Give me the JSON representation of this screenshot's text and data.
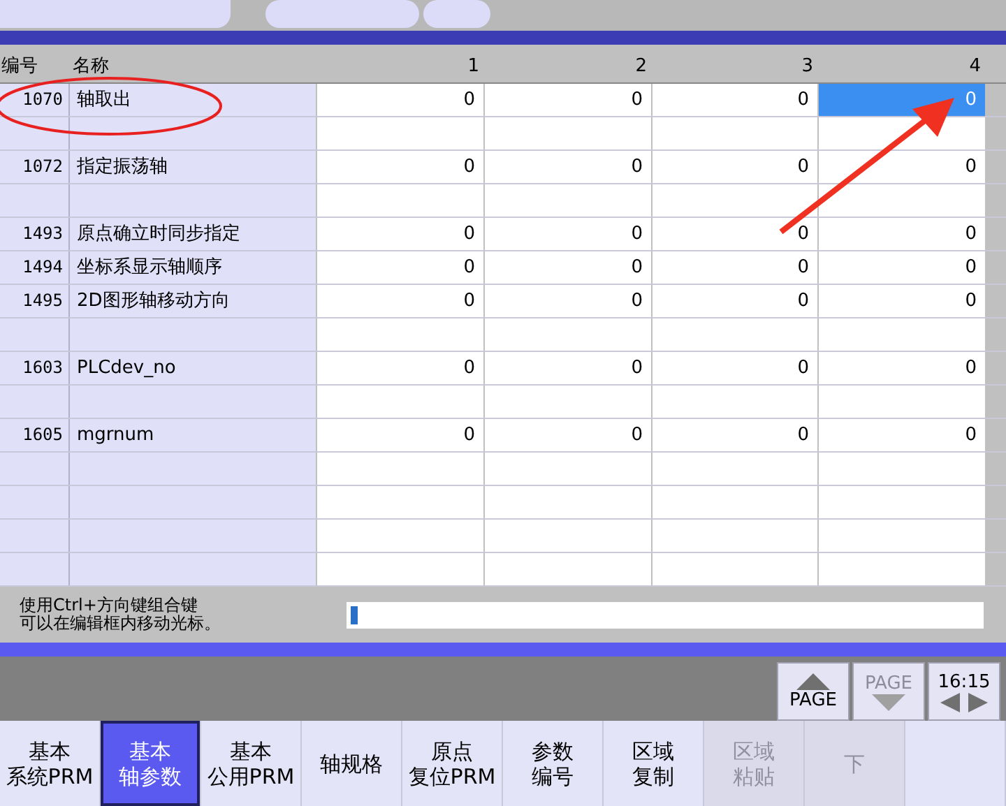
{
  "top_tabs": [
    {
      "selected": false
    },
    {
      "selected": false
    },
    {
      "selected": false
    }
  ],
  "table": {
    "columns": [
      "编号",
      "名称",
      "1",
      "2",
      "3",
      "4"
    ],
    "rows": [
      {
        "kind": "param",
        "number": "1070",
        "name": "轴取出",
        "values": [
          {
            "text": "0",
            "selected": false
          },
          {
            "text": "0",
            "selected": false
          },
          {
            "text": "0",
            "selected": false
          },
          {
            "text": "0",
            "selected": true
          }
        ]
      },
      {
        "kind": "blank"
      },
      {
        "kind": "param",
        "number": "1072",
        "name": "指定振荡轴",
        "values": [
          {
            "text": "0",
            "selected": false
          },
          {
            "text": "0",
            "selected": false
          },
          {
            "text": "0",
            "selected": false
          },
          {
            "text": "0",
            "selected": false
          }
        ]
      },
      {
        "kind": "blank"
      },
      {
        "kind": "param",
        "number": "1493",
        "name": "原点确立时同步指定",
        "values": [
          {
            "text": "0",
            "selected": false
          },
          {
            "text": "0",
            "selected": false
          },
          {
            "text": "0",
            "selected": false
          },
          {
            "text": "0",
            "selected": false
          }
        ]
      },
      {
        "kind": "param",
        "number": "1494",
        "name": "坐标系显示轴顺序",
        "values": [
          {
            "text": "0",
            "selected": false
          },
          {
            "text": "0",
            "selected": false
          },
          {
            "text": "0",
            "selected": false
          },
          {
            "text": "0",
            "selected": false
          }
        ]
      },
      {
        "kind": "param",
        "number": "1495",
        "name": "2D图形轴移动方向",
        "values": [
          {
            "text": "0",
            "selected": false
          },
          {
            "text": "0",
            "selected": false
          },
          {
            "text": "0",
            "selected": false
          },
          {
            "text": "0",
            "selected": false
          }
        ]
      },
      {
        "kind": "blank"
      },
      {
        "kind": "param",
        "number": "1603",
        "name": "PLCdev_no",
        "values": [
          {
            "text": "0",
            "selected": false
          },
          {
            "text": "0",
            "selected": false
          },
          {
            "text": "0",
            "selected": false
          },
          {
            "text": "0",
            "selected": false
          }
        ]
      },
      {
        "kind": "blank"
      },
      {
        "kind": "param",
        "number": "1605",
        "name": "mgrnum",
        "values": [
          {
            "text": "0",
            "selected": false
          },
          {
            "text": "0",
            "selected": false
          },
          {
            "text": "0",
            "selected": false
          },
          {
            "text": "0",
            "selected": false
          }
        ]
      },
      {
        "kind": "blank"
      },
      {
        "kind": "blank"
      },
      {
        "kind": "blank"
      },
      {
        "kind": "blank"
      }
    ]
  },
  "message": {
    "lines": [
      "使用Ctrl+方向键组合键",
      "可以在编辑框内移动光标。"
    ]
  },
  "page_buttons": [
    {
      "kind": "page_up",
      "label": "PAGE",
      "disabled": false
    },
    {
      "kind": "page_down",
      "label": "PAGE",
      "disabled": true
    },
    {
      "kind": "clock",
      "label": "16:15",
      "disabled": false
    }
  ],
  "softkeys": [
    {
      "lines": [
        "基本",
        "系统PRM"
      ],
      "selected": false,
      "disabled": false
    },
    {
      "lines": [
        "基本",
        "轴参数"
      ],
      "selected": true,
      "disabled": false
    },
    {
      "lines": [
        "基本",
        "公用PRM"
      ],
      "selected": false,
      "disabled": false
    },
    {
      "lines": [
        "轴规格"
      ],
      "selected": false,
      "disabled": false
    },
    {
      "lines": [
        "原点",
        "复位PRM"
      ],
      "selected": false,
      "disabled": false
    },
    {
      "lines": [
        "参数",
        "编号"
      ],
      "selected": false,
      "disabled": false
    },
    {
      "lines": [
        "区域",
        "复制"
      ],
      "selected": false,
      "disabled": false
    },
    {
      "lines": [
        "区域",
        "粘贴"
      ],
      "selected": false,
      "disabled": true
    },
    {
      "lines": [
        "下"
      ],
      "selected": false,
      "disabled": true
    },
    {
      "selected": false,
      "disabled": false
    }
  ]
}
